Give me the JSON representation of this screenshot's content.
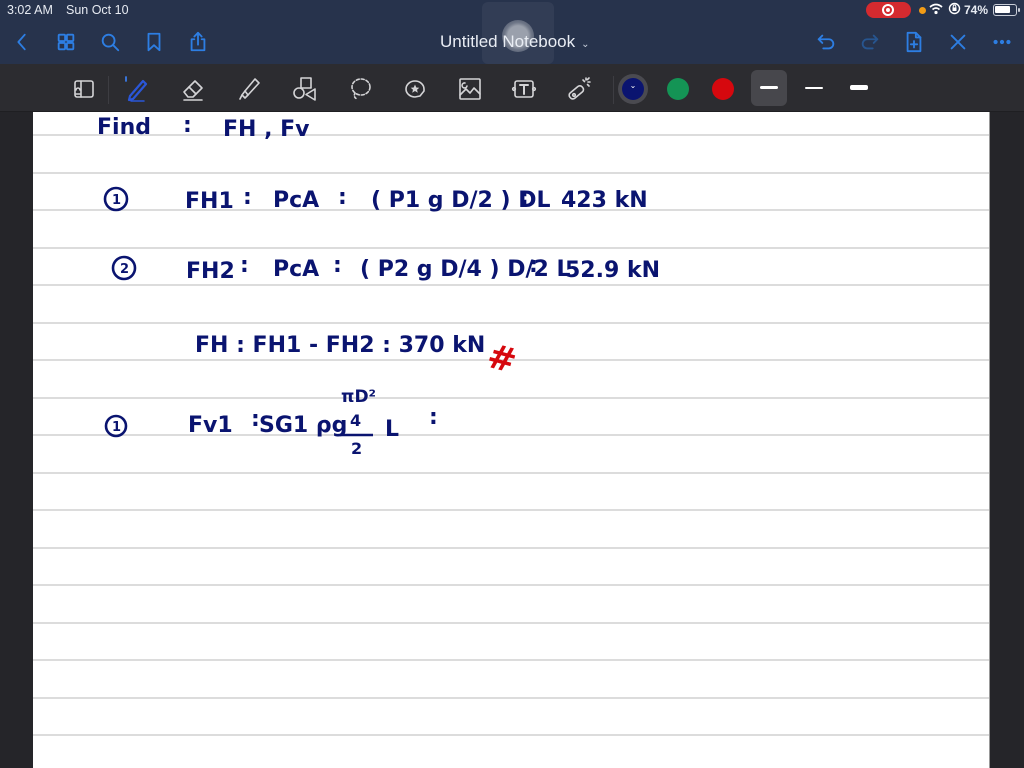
{
  "status_bar": {
    "time": "3:02 AM",
    "date": "Sun Oct 10",
    "battery_percent": "74%",
    "recording": true,
    "icons": [
      "screen-record-icon",
      "mic-indicator-dot",
      "wifi-icon",
      "rotation-lock-icon",
      "battery-icon"
    ]
  },
  "nav_bar": {
    "title": "Untitled Notebook",
    "title_chevron": "⌄",
    "left_buttons": [
      "back",
      "thumbnails",
      "search",
      "bookmark",
      "share"
    ],
    "right_buttons": [
      "undo",
      "redo",
      "add-page",
      "close",
      "more"
    ]
  },
  "toolbar": {
    "tools": [
      "zoom-window",
      "pen",
      "eraser",
      "highlighter",
      "shapes",
      "lasso",
      "stickers",
      "image",
      "text",
      "laser-pointer"
    ],
    "selected_tool": "pen",
    "colors": [
      {
        "name": "navy",
        "hex": "#0a1470",
        "selected": true
      },
      {
        "name": "green",
        "hex": "#149455",
        "selected": false
      },
      {
        "name": "red",
        "hex": "#d6080e",
        "selected": false
      }
    ],
    "thicknesses": [
      {
        "name": "medium",
        "selected": true
      },
      {
        "name": "thin",
        "selected": false
      },
      {
        "name": "thick",
        "selected": false
      }
    ]
  },
  "notes": {
    "line1": {
      "label": "Find",
      "colon": ":",
      "text": "FH , Fv"
    },
    "line2": {
      "num": "1",
      "lhs": "FH1",
      "eq": ":",
      "mid": "PcA",
      "eq2": ":",
      "expr": "( P1 g D/2 ) DL",
      "eq3": ":",
      "result": "423 kN"
    },
    "line3": {
      "num": "2",
      "lhs": "FH2",
      "eq": ":",
      "mid": "PcA",
      "eq2": ":",
      "expr": "( P2 g D/4 ) D/2 L",
      "eq3": ":",
      "result": "52.9 kN"
    },
    "line4": {
      "text": "FH : FH1 - FH2 : 370 kN",
      "mark": "#"
    },
    "line5": {
      "num": "1",
      "lhs": "Fv1",
      "eq": ":",
      "expr": "SG1 ρg",
      "frac_top": "πD²",
      "frac_mid": "4",
      "frac_bot": "2",
      "tail": "L",
      "eq2": ":"
    }
  }
}
